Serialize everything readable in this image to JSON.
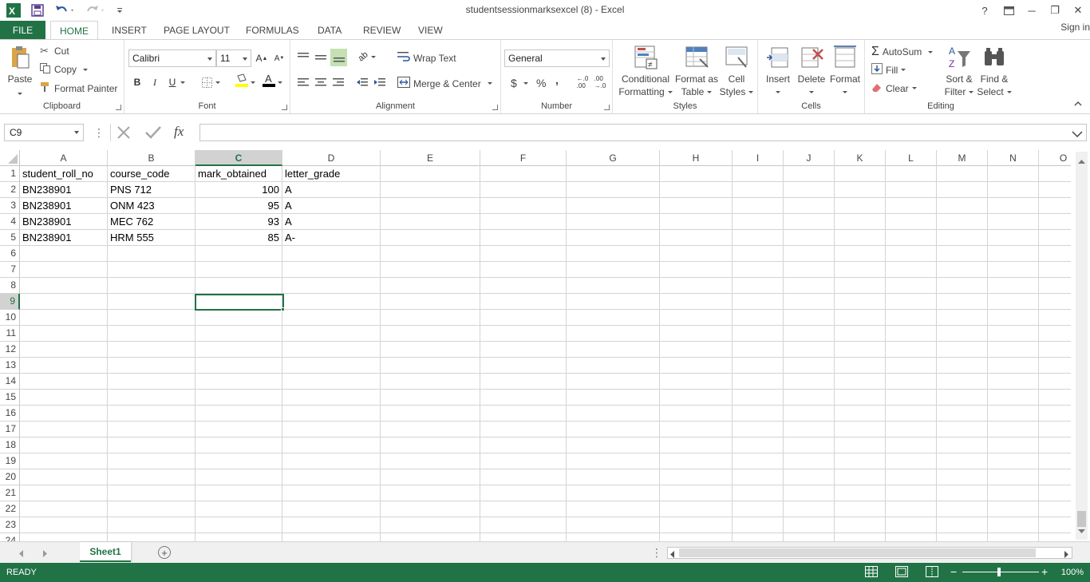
{
  "app": {
    "title": "studentsessionmarksexcel (8) - Excel",
    "accent": "#217346"
  },
  "window": {
    "help": "?",
    "minimize": "─",
    "restore": "❐",
    "close": "✕"
  },
  "tabs": {
    "file": "FILE",
    "items": [
      "HOME",
      "INSERT",
      "PAGE LAYOUT",
      "FORMULAS",
      "DATA",
      "REVIEW",
      "VIEW"
    ],
    "signin": "Sign in"
  },
  "ribbon": {
    "clipboard": {
      "label": "Clipboard",
      "paste": "Paste",
      "cut": "Cut",
      "copy": "Copy",
      "format_painter": "Format Painter"
    },
    "font": {
      "label": "Font",
      "name": "Calibri",
      "size": "11",
      "bold": "B",
      "italic": "I",
      "underline": "U"
    },
    "alignment": {
      "label": "Alignment",
      "wrap": "Wrap Text",
      "merge": "Merge & Center"
    },
    "number": {
      "label": "Number",
      "format": "General",
      "currency": "$",
      "percent": "%",
      "comma": ","
    },
    "styles": {
      "label": "Styles",
      "conditional": [
        "Conditional",
        "Formatting"
      ],
      "format_table": [
        "Format as",
        "Table"
      ],
      "cell_styles": [
        "Cell",
        "Styles"
      ]
    },
    "cells": {
      "label": "Cells",
      "insert": "Insert",
      "delete": "Delete",
      "format": "Format"
    },
    "editing": {
      "label": "Editing",
      "autosum": "AutoSum",
      "fill": "Fill",
      "clear": "Clear",
      "sort": [
        "Sort &",
        "Filter"
      ],
      "find": [
        "Find &",
        "Select"
      ]
    }
  },
  "formula_bar": {
    "name_box": "C9",
    "fx": "fx",
    "value": ""
  },
  "sheet": {
    "columns": [
      "A",
      "B",
      "C",
      "D",
      "E",
      "F",
      "G",
      "H",
      "I",
      "J",
      "K",
      "L",
      "M",
      "N",
      "O"
    ],
    "selected_column": "C",
    "selected_row": 9,
    "rows": [
      1,
      2,
      3,
      4,
      5,
      6,
      7,
      8,
      9,
      10,
      11,
      12,
      13,
      14,
      15,
      16,
      17,
      18,
      19,
      20,
      21,
      22,
      23,
      24
    ],
    "cells": {
      "A1": "student_roll_no",
      "B1": "course_code",
      "C1": "mark_obtained",
      "D1": "letter_grade",
      "A2": "BN238901",
      "B2": "PNS 712",
      "C2": "100",
      "D2": "A",
      "A3": "BN238901",
      "B3": "ONM 423",
      "C3": "95",
      "D3": "A",
      "A4": "BN238901",
      "B4": "MEC 762",
      "C4": "93",
      "D4": "A",
      "A5": "BN238901",
      "B5": "HRM 555",
      "C5": "85",
      "D5": "A-"
    }
  },
  "sheet_tabs": {
    "active": "Sheet1"
  },
  "status": {
    "ready": "READY",
    "zoom": "100%"
  }
}
